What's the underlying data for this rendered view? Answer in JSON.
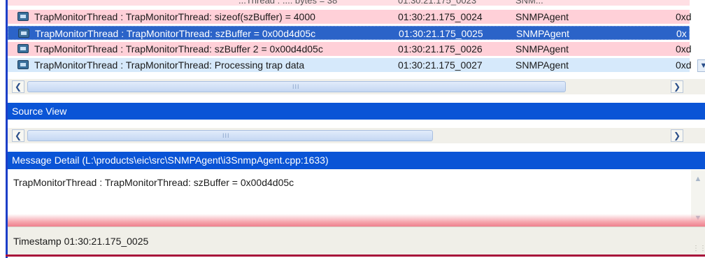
{
  "log": {
    "partial_row": {
      "msg": "...Thread : ...: bytes = 38",
      "ts": "01:30:21.175_0023",
      "src": "SNM..."
    },
    "rows": [
      {
        "msg": "TrapMonitorThread : TrapMonitorThread: sizeof(szBuffer) = 4000",
        "ts": "01:30:21.175_0024",
        "src": "SNMPAgent",
        "th": "0xd",
        "style": "pink"
      },
      {
        "msg": "TrapMonitorThread : TrapMonitorThread: szBuffer = 0x00d4d05c",
        "ts": "01:30:21.175_0025",
        "src": "SNMPAgent",
        "th": "0x",
        "style": "selected"
      },
      {
        "msg": "TrapMonitorThread : TrapMonitorThread: szBuffer 2 = 0x00d4d05c",
        "ts": "01:30:21.175_0026",
        "src": "SNMPAgent",
        "th": "0xd",
        "style": "pink"
      },
      {
        "msg": "TrapMonitorThread : TrapMonitorThread: Processing trap data",
        "ts": "01:30:21.175_0027",
        "src": "SNMPAgent",
        "th": "0xd",
        "style": "light"
      }
    ]
  },
  "source_view": {
    "title": "Source View"
  },
  "message_detail": {
    "title": "Message Detail (L:\\products\\eic\\src\\SNMPAgent\\i3SnmpAgent.cpp:1633)",
    "text": "TrapMonitorThread : TrapMonitorThread: szBuffer = 0x00d4d05c"
  },
  "status": {
    "text": "Timestamp 01:30:21.175_0025"
  },
  "icons": {
    "row_icon": "log-entry-icon",
    "scroll_left": "arrow-left-icon",
    "scroll_right": "arrow-right-icon",
    "scroll_up": "arrow-up-icon",
    "scroll_down": "arrow-down-icon"
  },
  "colors": {
    "header_blue": "#0a54d6",
    "selected_row": "#2b63c8",
    "error_row_pink": "#ffd0d8",
    "info_row_blue": "#d6e9fb"
  }
}
